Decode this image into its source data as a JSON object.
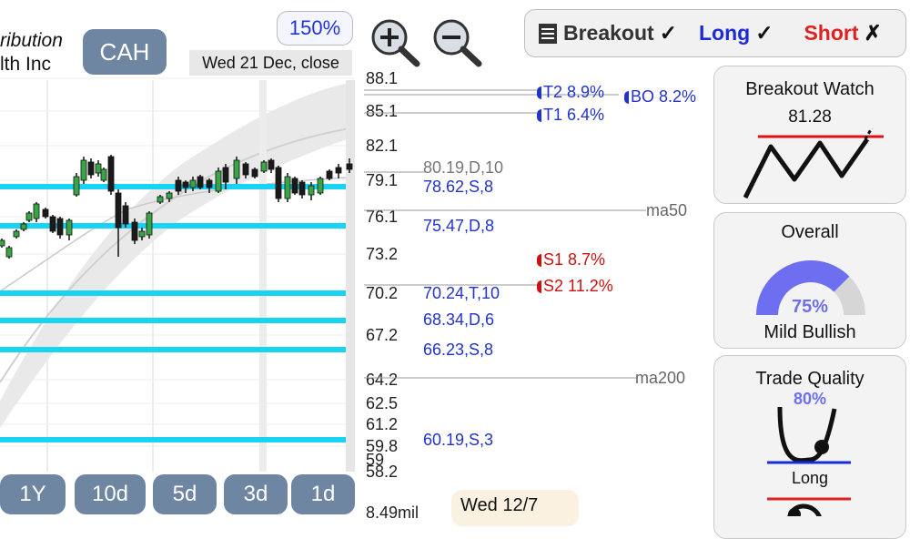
{
  "company": {
    "line1": "ribution",
    "line2": "lth Inc"
  },
  "ticker": "CAH",
  "zoom_level": "150%",
  "date_label": "Wed 21 Dec, close",
  "icons": {
    "zoom_in": "zoom-in-icon",
    "zoom_out": "zoom-out-icon"
  },
  "toolbar": {
    "breakout_label": "Breakout",
    "breakout_mark": "✓",
    "long_label": "Long",
    "long_mark": "✓",
    "short_label": "Short",
    "short_mark": "✗"
  },
  "price_axis": [
    "88.1",
    "85.1",
    "82.1",
    "79.1",
    "76.1",
    "73.2",
    "70.2",
    "67.2",
    "64.2",
    "62.5",
    "61.2",
    "59.8",
    "59",
    "58.2",
    "8.49mil"
  ],
  "levels": [
    {
      "text": "80.19,D,10",
      "color": "#777777"
    },
    {
      "text": "78.62,S,8",
      "color": "#2233cc"
    },
    {
      "text": "75.47,D,8",
      "color": "#2233cc"
    },
    {
      "text": "70.24,T,10",
      "color": "#2233cc"
    },
    {
      "text": "68.34,D,6",
      "color": "#2233cc"
    },
    {
      "text": "66.23,S,8",
      "color": "#2233cc"
    },
    {
      "text": "60.19,S,3",
      "color": "#2233cc"
    }
  ],
  "targets": [
    {
      "text": "T2 8.9%",
      "color": "#2233cc"
    },
    {
      "text": "BO 8.2%",
      "color": "#2233cc"
    },
    {
      "text": "T1 6.4%",
      "color": "#2233cc"
    },
    {
      "text": "S1 8.7%",
      "color": "#cc1111"
    },
    {
      "text": "S2 11.2%",
      "color": "#cc1111"
    }
  ],
  "moving_averages": [
    "ma50",
    "ma200"
  ],
  "range_buttons": [
    "1Y",
    "10d",
    "5d",
    "3d",
    "1d"
  ],
  "footer_date": "Wed 12/7",
  "panels": {
    "breakout_watch": {
      "title": "Breakout Watch",
      "value": "81.28"
    },
    "overall": {
      "title": "Overall",
      "percent": "75%",
      "percent_value": 75,
      "sentiment": "Mild Bullish"
    },
    "trade_quality": {
      "title": "Trade Quality",
      "percent": "80%",
      "side": "Long"
    }
  },
  "colors": {
    "accent_blue": "#2233cc",
    "support_cyan": "#19d3f5",
    "button_bg": "#6f86a3",
    "bear_red": "#cc1111",
    "gauge_fill": "#6e6ef0"
  }
}
